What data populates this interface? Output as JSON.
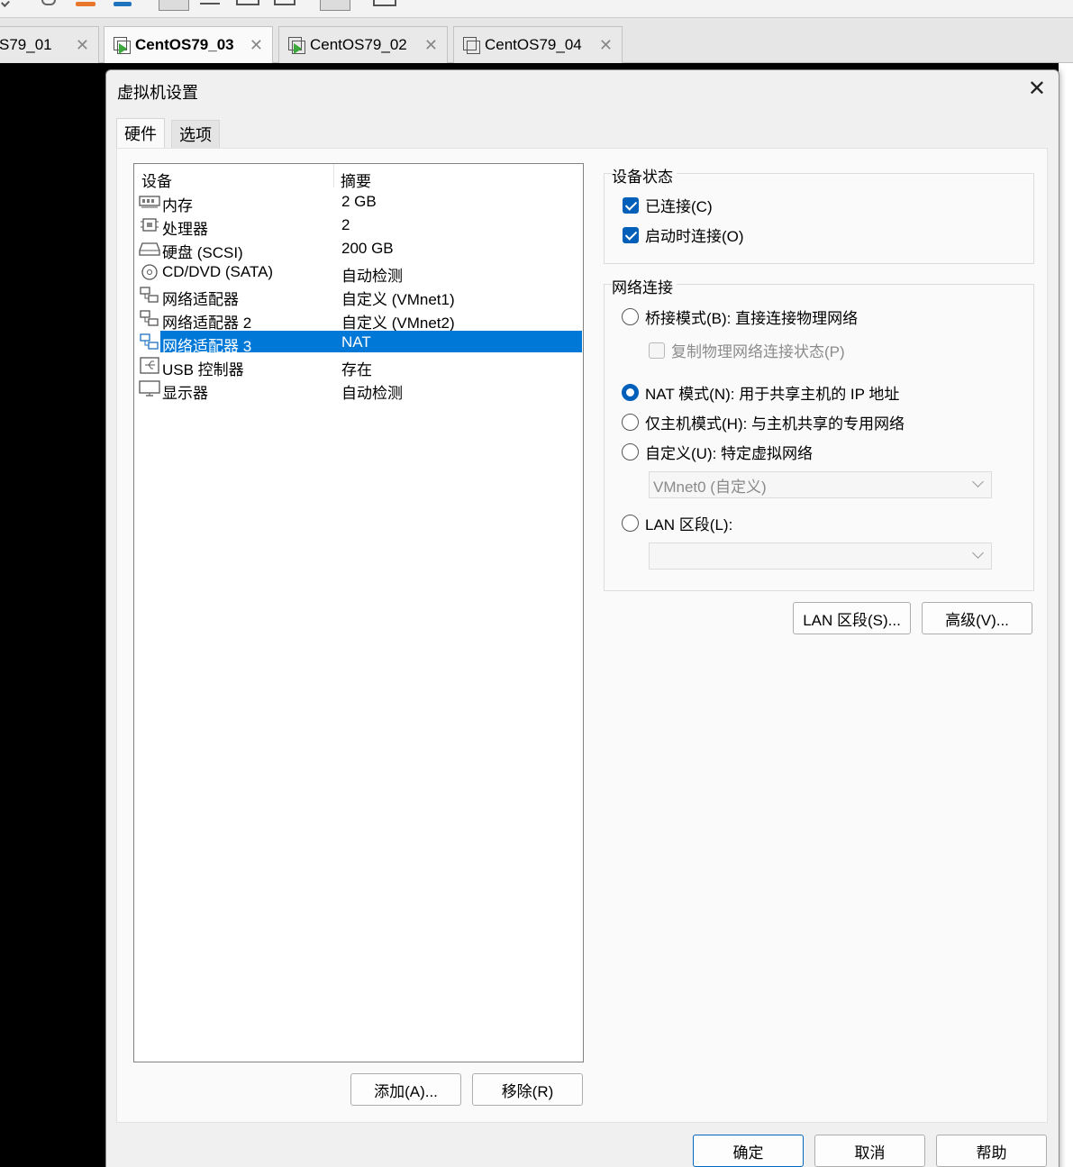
{
  "tabs": [
    {
      "label": "S79_01",
      "active": false
    },
    {
      "label": "CentOS79_03",
      "active": true
    },
    {
      "label": "CentOS79_02",
      "active": false
    },
    {
      "label": "CentOS79_04",
      "active": false
    }
  ],
  "dialog": {
    "title": "虚拟机设置",
    "tabs": [
      "硬件",
      "选项"
    ]
  },
  "devices": {
    "headers": [
      "设备",
      "摘要"
    ],
    "rows": [
      {
        "name": "内存",
        "summary": "2 GB",
        "icon": "memory-icon"
      },
      {
        "name": "处理器",
        "summary": "2",
        "icon": "cpu-icon"
      },
      {
        "name": "硬盘 (SCSI)",
        "summary": "200 GB",
        "icon": "harddisk-icon"
      },
      {
        "name": "CD/DVD (SATA)",
        "summary": "自动检测",
        "icon": "cd-dvd-icon"
      },
      {
        "name": "网络适配器",
        "summary": "自定义 (VMnet1)",
        "icon": "network-adapter-icon"
      },
      {
        "name": "网络适配器 2",
        "summary": "自定义 (VMnet2)",
        "icon": "network-adapter-icon"
      },
      {
        "name": "网络适配器 3",
        "summary": "NAT",
        "icon": "network-adapter-icon",
        "selected": true
      },
      {
        "name": "USB 控制器",
        "summary": "存在",
        "icon": "usb-icon"
      },
      {
        "name": "显示器",
        "summary": "自动检测",
        "icon": "monitor-icon"
      }
    ],
    "add_button": "添加(A)...",
    "remove_button": "移除(R)"
  },
  "device_status": {
    "title": "设备状态",
    "connected": "已连接(C)",
    "connect_at_power_on": "启动时连接(O)"
  },
  "network": {
    "title": "网络连接",
    "bridged": "桥接模式(B): 直接连接物理网络",
    "replicate": "复制物理网络连接状态(P)",
    "nat": "NAT 模式(N): 用于共享主机的 IP 地址",
    "host_only": "仅主机模式(H): 与主机共享的专用网络",
    "custom": "自定义(U): 特定虚拟网络",
    "custom_value": "VMnet0 (自定义)",
    "lan": "LAN 区段(L):",
    "lan_value": "",
    "selected": "nat"
  },
  "buttons": {
    "lan_segments": "LAN 区段(S)...",
    "advanced": "高级(V)...",
    "ok": "确定",
    "cancel": "取消",
    "help": "帮助"
  },
  "colors": {
    "accent": "#005fb8",
    "selection": "#0078d7"
  }
}
